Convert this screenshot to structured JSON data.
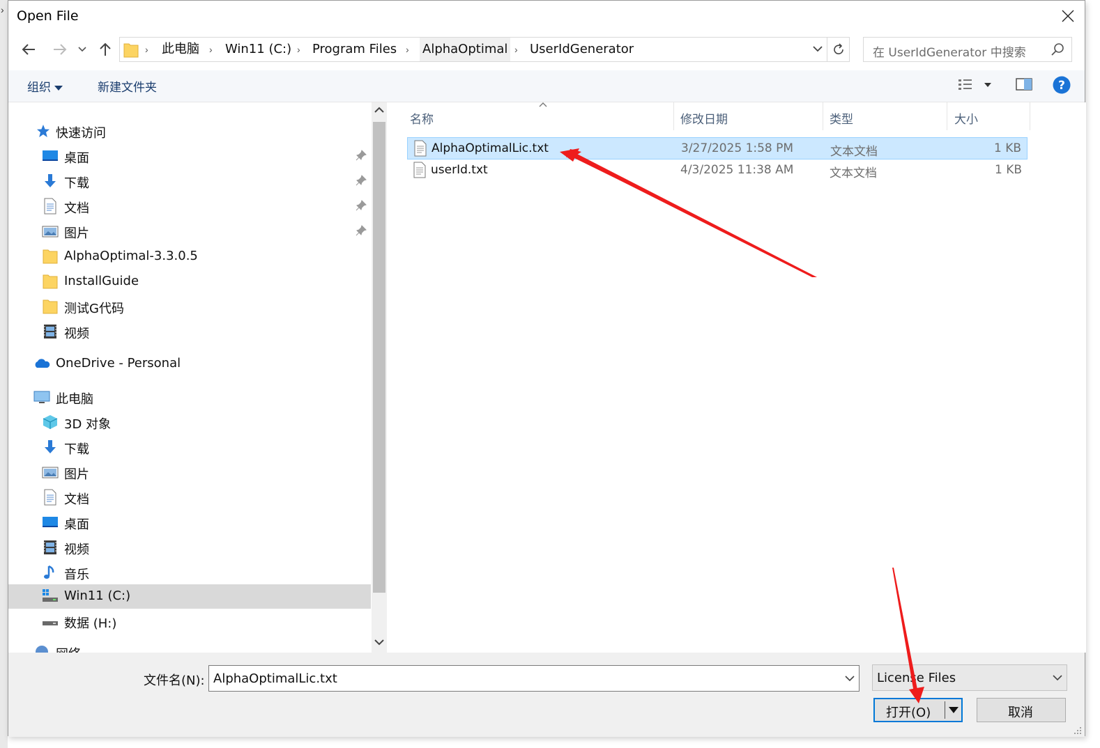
{
  "window": {
    "title": "Open File"
  },
  "address": {
    "crumbs": [
      "此电脑",
      "Win11 (C:)",
      "Program Files",
      "AlphaOptimal",
      "UserIdGenerator"
    ]
  },
  "search": {
    "placeholder": "在 UserIdGenerator 中搜索"
  },
  "toolbar": {
    "organize": "组织",
    "new_folder": "新建文件夹"
  },
  "nav": {
    "quick_access": "快速访问",
    "items": [
      {
        "label": "桌面",
        "icon": "desktop-icon"
      },
      {
        "label": "下载",
        "icon": "download-icon"
      },
      {
        "label": "文档",
        "icon": "document-icon"
      },
      {
        "label": "图片",
        "icon": "pictures-icon"
      },
      {
        "label": "AlphaOptimal-3.3.0.5",
        "icon": "folder-icon"
      },
      {
        "label": "InstallGuide",
        "icon": "folder-icon"
      },
      {
        "label": "测试G代码",
        "icon": "folder-icon"
      },
      {
        "label": "视频",
        "icon": "video-icon"
      }
    ],
    "onedrive": "OneDrive - Personal",
    "this_pc": "此电脑",
    "pc_items": [
      {
        "label": "3D 对象",
        "icon": "3d-objects-icon"
      },
      {
        "label": "下载",
        "icon": "download-icon"
      },
      {
        "label": "图片",
        "icon": "pictures-icon"
      },
      {
        "label": "文档",
        "icon": "document-icon"
      },
      {
        "label": "桌面",
        "icon": "desktop-icon"
      },
      {
        "label": "视频",
        "icon": "video-icon"
      },
      {
        "label": "音乐",
        "icon": "music-icon"
      },
      {
        "label": "Win11 (C:)",
        "icon": "drive-c-icon"
      },
      {
        "label": "数据 (H:)",
        "icon": "drive-h-icon"
      }
    ],
    "network_partial": "网络"
  },
  "columns": {
    "name": "名称",
    "date": "修改日期",
    "type": "类型",
    "size": "大小"
  },
  "files": [
    {
      "name": "AlphaOptimalLic.txt",
      "date": "3/27/2025 1:58 PM",
      "type": "文本文档",
      "size": "1 KB",
      "selected": true
    },
    {
      "name": "userId.txt",
      "date": "4/3/2025 11:38 AM",
      "type": "文本文档",
      "size": "1 KB",
      "selected": false
    }
  ],
  "bottom": {
    "filename_label": "文件名(N):",
    "filename_value": "AlphaOptimalLic.txt",
    "filter": "License Files",
    "open_label": "打开(O)",
    "cancel_label": "取消"
  },
  "annotation_color": "#ee1c1c",
  "selection_color": "#cce8ff"
}
